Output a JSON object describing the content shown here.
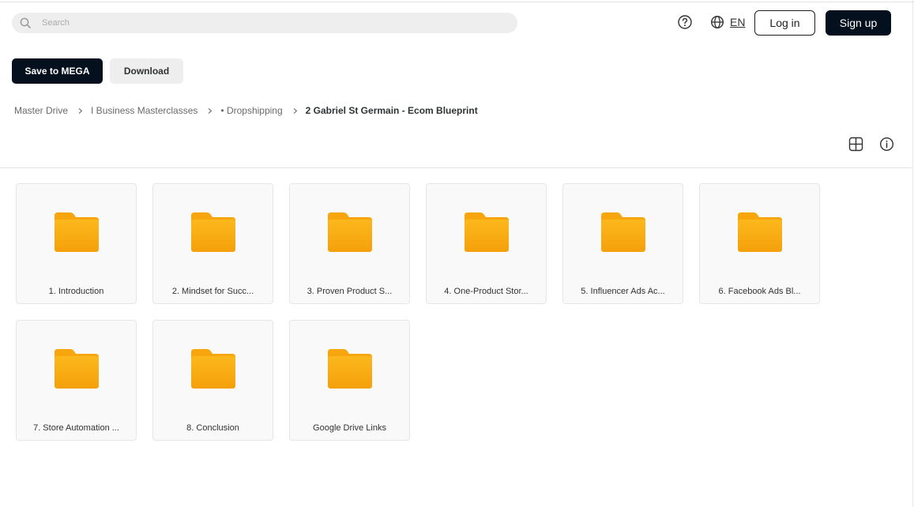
{
  "search": {
    "placeholder": "Search",
    "value": ""
  },
  "header": {
    "language": "EN",
    "login_label": "Log in",
    "signup_label": "Sign up"
  },
  "actions": {
    "save_label": "Save to MEGA",
    "download_label": "Download"
  },
  "breadcrumb": {
    "items": [
      "Master Drive",
      "I Business Masterclasses",
      "• Dropshipping"
    ],
    "current": "2 Gabriel St Germain - Ecom Blueprint"
  },
  "folders": [
    {
      "name": "1. Introduction"
    },
    {
      "name": "2. Mindset for Succ..."
    },
    {
      "name": "3. Proven Product S..."
    },
    {
      "name": "4. One-Product Stor..."
    },
    {
      "name": "5. Influencer Ads Ac..."
    },
    {
      "name": "6. Facebook Ads Bl..."
    },
    {
      "name": "7. Store Automation ..."
    },
    {
      "name": "8. Conclusion"
    },
    {
      "name": "Google Drive Links"
    }
  ],
  "icons": {
    "search": "search-icon",
    "help": "help-icon",
    "globe": "globe-icon",
    "chevron": "chevron-right-icon",
    "grid_view": "grid-view-icon",
    "info": "info-icon",
    "folder": "folder-icon"
  },
  "colors": {
    "primary": "#04101e",
    "folder_top": "#fbb81c",
    "folder_bottom": "#f5a00b",
    "tile_bg": "#f9f9f9"
  }
}
